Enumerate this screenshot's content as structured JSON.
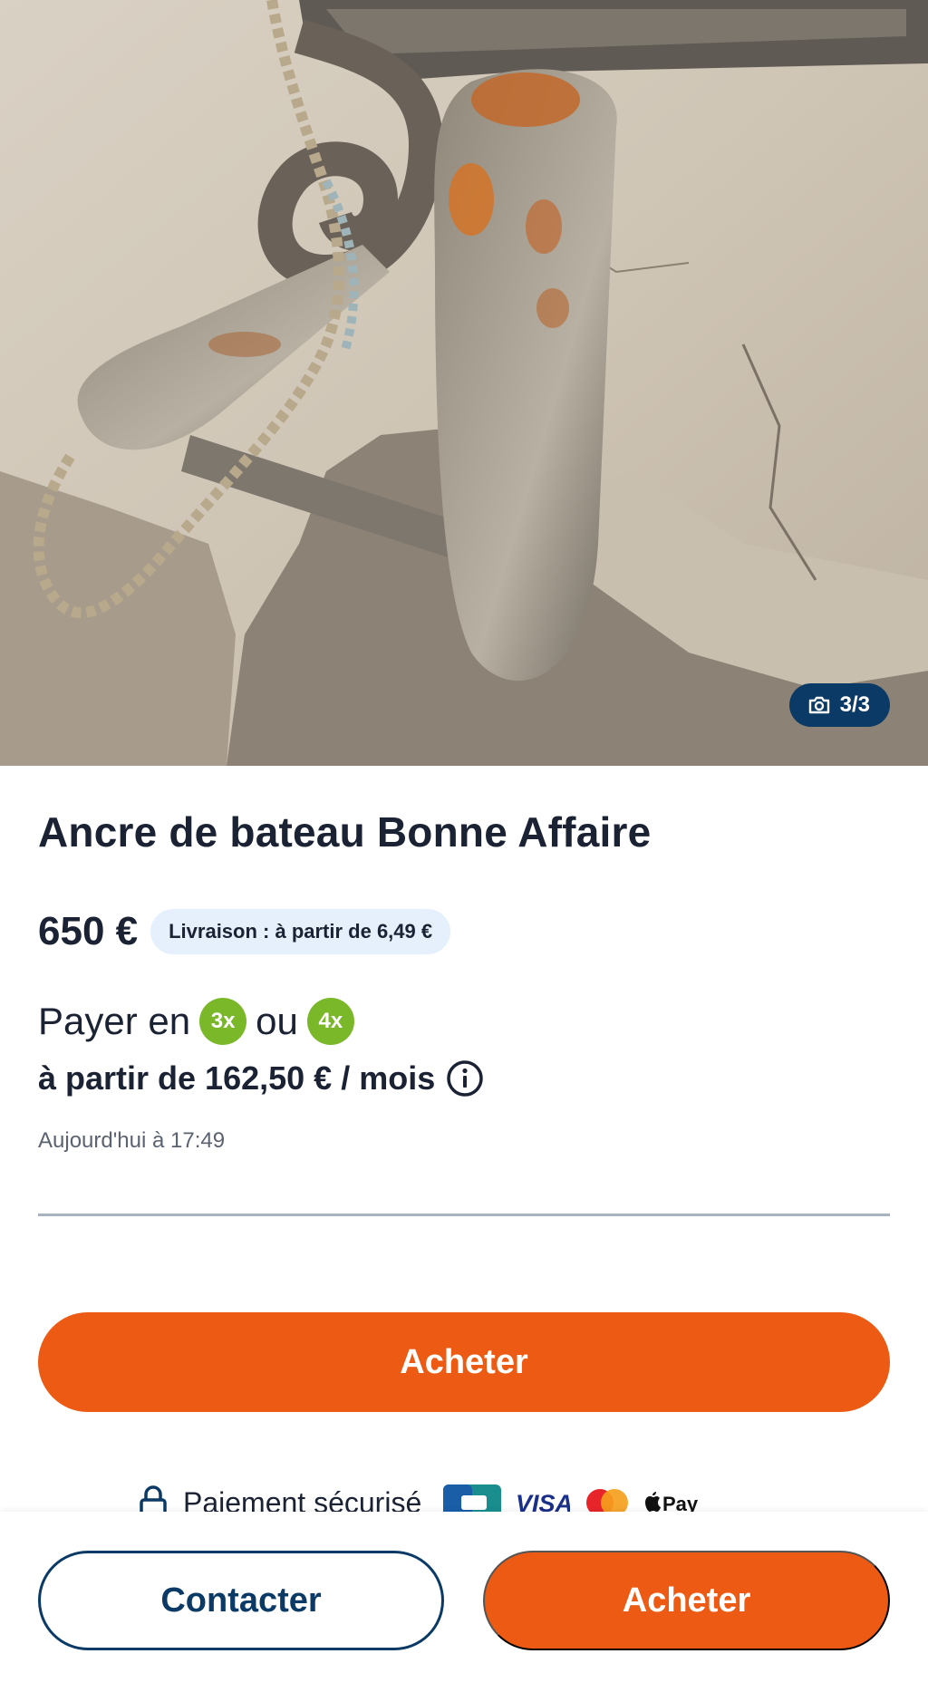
{
  "listing": {
    "photo": {
      "counter": "3/3",
      "subject": "rusty boat anchor on stone"
    },
    "title": "Ancre de bateau Bonne Affaire",
    "price": "650 €",
    "delivery_badge": "Livraison : à partir de 6,49 €",
    "payment": {
      "prefix": "Payer en",
      "option_3x": "3x",
      "separator": "ou",
      "option_4x": "4x",
      "monthly": "à partir de 162,50 € / mois"
    },
    "posted": "Aujourd'hui à 17:49"
  },
  "actions": {
    "buy_label": "Acheter",
    "contact_label": "Contacter",
    "bottom_buy_label": "Acheter"
  },
  "secure": {
    "label": "Paiement sécurisé",
    "logos": [
      "CB",
      "VISA",
      "Mastercard",
      "Apple Pay"
    ]
  },
  "colors": {
    "accent": "#ec5a13",
    "navy": "#0b3a66",
    "installment_green": "#7ab829",
    "badge_bg": "#e5f0fc"
  },
  "icons": [
    "camera-icon",
    "info-icon",
    "lock-icon"
  ]
}
